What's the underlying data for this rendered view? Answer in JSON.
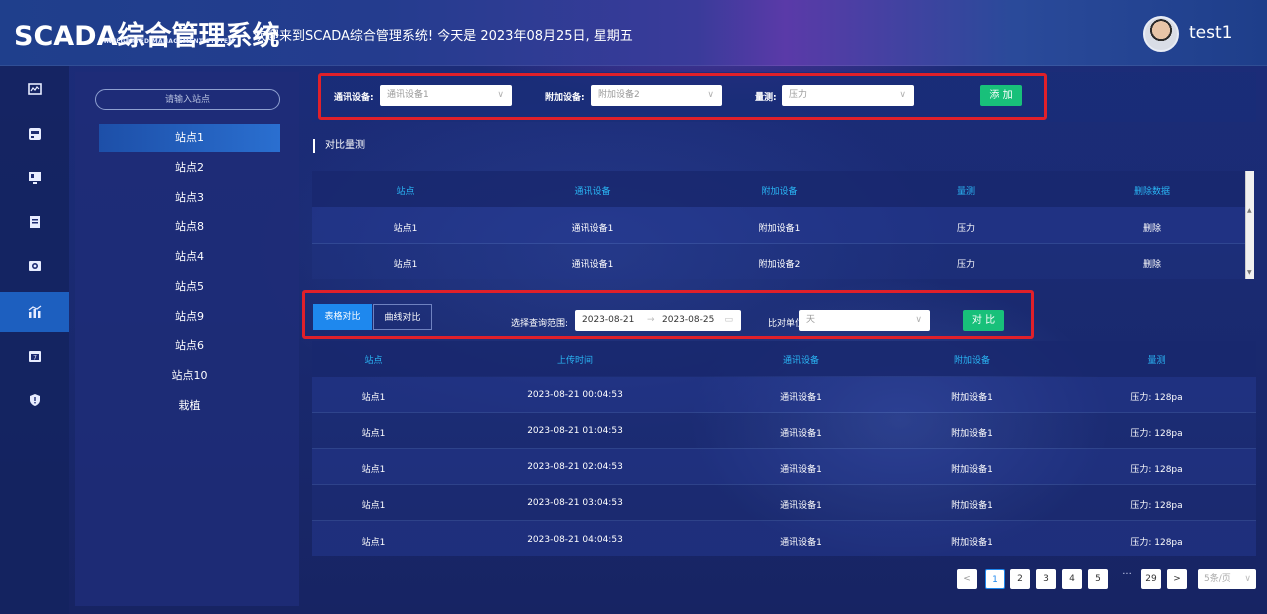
{
  "header": {
    "logo_main": "SCADA综合管理系统",
    "logo_sub": "INTEGRATED MANAGEMENT SYSTEM",
    "welcome": "欢迎来到SCADA综合管理系统!  今天是 2023年08月25日, 星期五",
    "username": "test1"
  },
  "rail": {
    "items": [
      {
        "icon": "chart-monitor-icon"
      },
      {
        "icon": "device-icon"
      },
      {
        "icon": "screen-icon"
      },
      {
        "icon": "report-icon"
      },
      {
        "icon": "camera-icon"
      },
      {
        "icon": "bar-chart-icon",
        "active": true
      },
      {
        "icon": "calendar-icon"
      },
      {
        "icon": "alert-shield-icon"
      }
    ]
  },
  "stations": {
    "search_placeholder": "请输入站点",
    "items": [
      "站点1",
      "站点2",
      "站点3",
      "站点8",
      "站点4",
      "站点5",
      "站点9",
      "站点6",
      "站点10",
      "栽植"
    ],
    "active_index": 0
  },
  "filter": {
    "comm_label": "通讯设备:",
    "comm_value": "通讯设备1",
    "addon_label": "附加设备:",
    "addon_value": "附加设备2",
    "measure_label": "量测:",
    "measure_value": "压力",
    "add_button": "添 加"
  },
  "compare_section": {
    "title": "对比量测",
    "headers": [
      "站点",
      "通讯设备",
      "附加设备",
      "量测",
      "删除数据"
    ],
    "rows": [
      [
        "站点1",
        "通讯设备1",
        "附加设备1",
        "压力",
        "删除"
      ],
      [
        "站点1",
        "通讯设备1",
        "附加设备2",
        "压力",
        "删除"
      ]
    ]
  },
  "query": {
    "tab_table": "表格对比",
    "tab_curve": "曲线对比",
    "range_label": "选择查询范围:",
    "date_start": "2023-08-21",
    "date_sep": "→",
    "date_end": "2023-08-25",
    "unit_label": "比对单位:",
    "unit_value": "天",
    "compare_button": "对 比"
  },
  "result_table": {
    "headers": [
      "站点",
      "上传时间",
      "通讯设备",
      "附加设备",
      "量测"
    ],
    "rows": [
      [
        "站点1",
        "2023-08-21 00:04:53",
        "通讯设备1",
        "附加设备1",
        "压力: 128pa"
      ],
      [
        "站点1",
        "2023-08-21 01:04:53",
        "通讯设备1",
        "附加设备1",
        "压力: 128pa"
      ],
      [
        "站点1",
        "2023-08-21 02:04:53",
        "通讯设备1",
        "附加设备1",
        "压力: 128pa"
      ],
      [
        "站点1",
        "2023-08-21 03:04:53",
        "通讯设备1",
        "附加设备1",
        "压力: 128pa"
      ],
      [
        "站点1",
        "2023-08-21 04:04:53",
        "通讯设备1",
        "附加设备1",
        "压力: 128pa"
      ]
    ]
  },
  "pagination": {
    "prev": "<",
    "pages": [
      "1",
      "2",
      "3",
      "4",
      "5"
    ],
    "ellipsis": "···",
    "last": "29",
    "next": ">",
    "page_size": "5条/页",
    "active_page": "1"
  },
  "colors": {
    "accent_blue": "#1e88ee",
    "header_text": "#2ab6f5",
    "green_button": "#18c07a",
    "highlight_border": "#e0202a"
  }
}
